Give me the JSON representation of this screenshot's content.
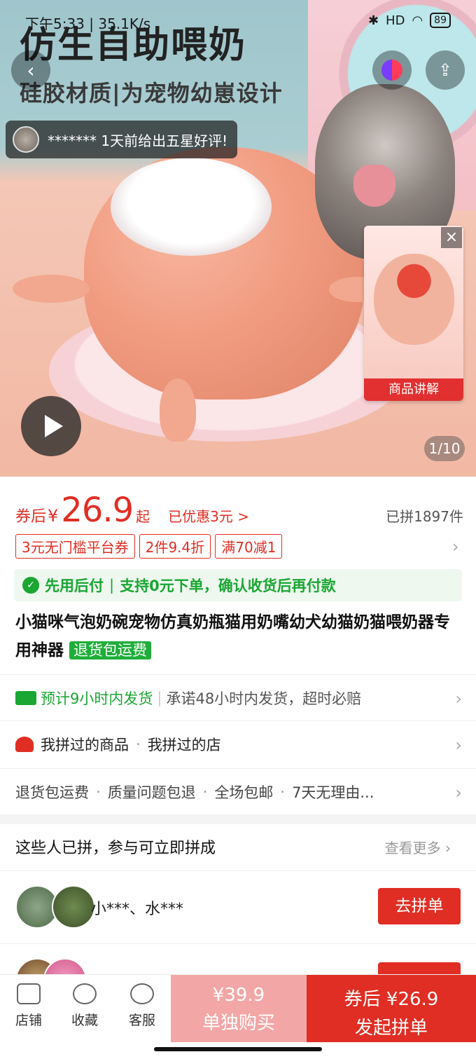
{
  "status_bar": {
    "time": "下午5:33 | 35.1K/s",
    "battery": "89",
    "signal": "HD"
  },
  "hero": {
    "headline": "仿生自助喂奶",
    "subline": "硅胶材质|为宠物幼崽设计",
    "review_toast": "******* 1天前给出五星好评!",
    "mini_video_label": "商品讲解",
    "page_indicator": "1/10",
    "icons": {
      "back": "chevron-left-icon",
      "share": "share-icon",
      "close": "close-icon",
      "play": "play-icon"
    }
  },
  "price": {
    "prefix": "券后",
    "currency": "¥",
    "amount": "26.9",
    "suffix": "起",
    "discount": "已优惠3元 >",
    "sold": "已拼1897件"
  },
  "coupons": [
    "3元无门槛平台券",
    "2件9.4折",
    "满70减1"
  ],
  "pay_later": {
    "bold": "先用后付",
    "text": "支持0元下单，确认收货后再付款"
  },
  "product": {
    "title": "小猫咪气泡奶碗宠物仿真奶瓶猫用奶嘴幼犬幼猫奶猫喂奶器专用神器",
    "tag": "退货包运费"
  },
  "shipping": {
    "green": "预计9小时内发货",
    "gray": "承诺48小时内发货，超时必赔"
  },
  "history": {
    "item1": "我拼过的商品",
    "item2": "我拼过的店"
  },
  "services": [
    "退货包运费",
    "质量问题包退",
    "全场包邮",
    "7天无理由..."
  ],
  "group": {
    "heading": "这些人已拼，参与可立即拼成",
    "more": "查看更多",
    "rows": [
      {
        "names": "小***、水***",
        "button": "去拼单"
      }
    ]
  },
  "bottom_bar": {
    "tabs": [
      "店铺",
      "收藏",
      "客服"
    ],
    "solo_price": "¥39.9",
    "solo_label": "单独购买",
    "group_price": "券后 ¥26.9",
    "group_label": "发起拼单"
  },
  "colors": {
    "accent": "#e02e24",
    "green": "#1aa632"
  }
}
